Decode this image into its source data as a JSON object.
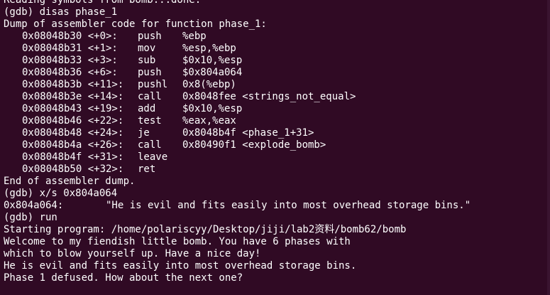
{
  "terminal": {
    "top_line": "Reading symbols from bomb...done.",
    "cmd_disas": "(gdb) disas phase_1",
    "dump_header": "Dump of assembler code for function phase_1:",
    "asm": [
      {
        "addr": "0x08048b30 <+0>:",
        "mnem": "push",
        "ops": "%ebp"
      },
      {
        "addr": "0x08048b31 <+1>:",
        "mnem": "mov",
        "ops": "%esp,%ebp"
      },
      {
        "addr": "0x08048b33 <+3>:",
        "mnem": "sub",
        "ops": "$0x10,%esp"
      },
      {
        "addr": "0x08048b36 <+6>:",
        "mnem": "push",
        "ops": "$0x804a064"
      },
      {
        "addr": "0x08048b3b <+11>:",
        "mnem": "pushl",
        "ops": "0x8(%ebp)"
      },
      {
        "addr": "0x08048b3e <+14>:",
        "mnem": "call",
        "ops": "0x8048fee <strings_not_equal>"
      },
      {
        "addr": "0x08048b43 <+19>:",
        "mnem": "add",
        "ops": "$0x10,%esp"
      },
      {
        "addr": "0x08048b46 <+22>:",
        "mnem": "test",
        "ops": "%eax,%eax"
      },
      {
        "addr": "0x08048b48 <+24>:",
        "mnem": "je",
        "ops": "0x8048b4f <phase_1+31>"
      },
      {
        "addr": "0x08048b4a <+26>:",
        "mnem": "call",
        "ops": "0x80490f1 <explode_bomb>"
      },
      {
        "addr": "0x08048b4f <+31>:",
        "mnem": "leave",
        "ops": ""
      },
      {
        "addr": "0x08048b50 <+32>:",
        "mnem": "ret",
        "ops": ""
      }
    ],
    "dump_end": "End of assembler dump.",
    "cmd_xs": "(gdb) x/s 0x804a064",
    "mem_addr": "0x804a064:",
    "mem_value": "\"He is evil and fits easily into most overhead storage bins.\"",
    "cmd_run": "(gdb) run",
    "starting": "Starting program: /home/polariscyy/Desktop/jiji/lab2资料/bomb62/bomb",
    "welcome_1": "Welcome to my fiendish little bomb. You have 6 phases with",
    "welcome_2": "which to blow yourself up. Have a nice day!",
    "input_echo": "He is evil and fits easily into most overhead storage bins.",
    "defused": "Phase 1 defused. How about the next one?"
  },
  "colors": {
    "background": "#300a24",
    "text": "#ffffff"
  }
}
